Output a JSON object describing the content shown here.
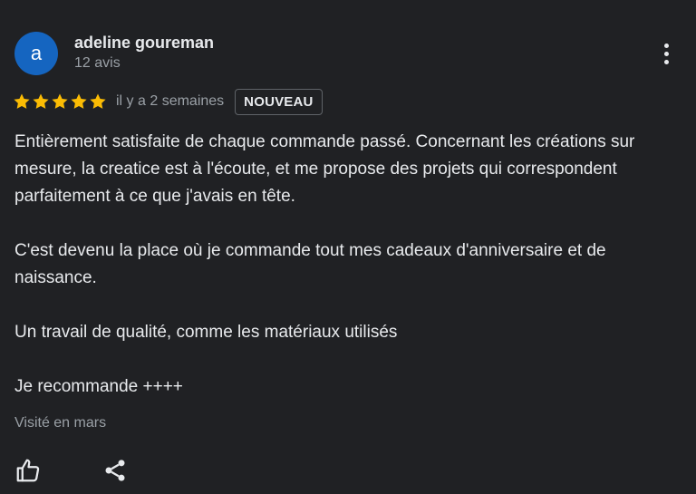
{
  "review": {
    "author": {
      "initial": "a",
      "name": "adeline goureman",
      "reviews_count": "12 avis"
    },
    "rating": 5,
    "rating_max": 5,
    "date": "il y a 2 semaines",
    "badge": "NOUVEAU",
    "paragraphs": [
      "Entièrement satisfaite de chaque commande passé. Concernant les créations sur mesure, la creatice est à l'écoute, et me propose des projets qui correspondent parfaitement à ce que j'avais en tête.",
      "C'est devenu la place où je commande tout mes cadeaux d'anniversaire et de naissance.",
      "Un travail de qualité, comme les matériaux utilisés",
      "Je recommande ++++"
    ],
    "visit": "Visité en mars"
  },
  "colors": {
    "background": "#202124",
    "avatar": "#1565c0",
    "star": "#fbbc04",
    "text_primary": "#e8eaed",
    "text_secondary": "#9aa0a6"
  },
  "icons": {
    "menu": "more-vertical-icon",
    "star": "star-icon",
    "like": "thumbs-up-icon",
    "share": "share-icon"
  }
}
